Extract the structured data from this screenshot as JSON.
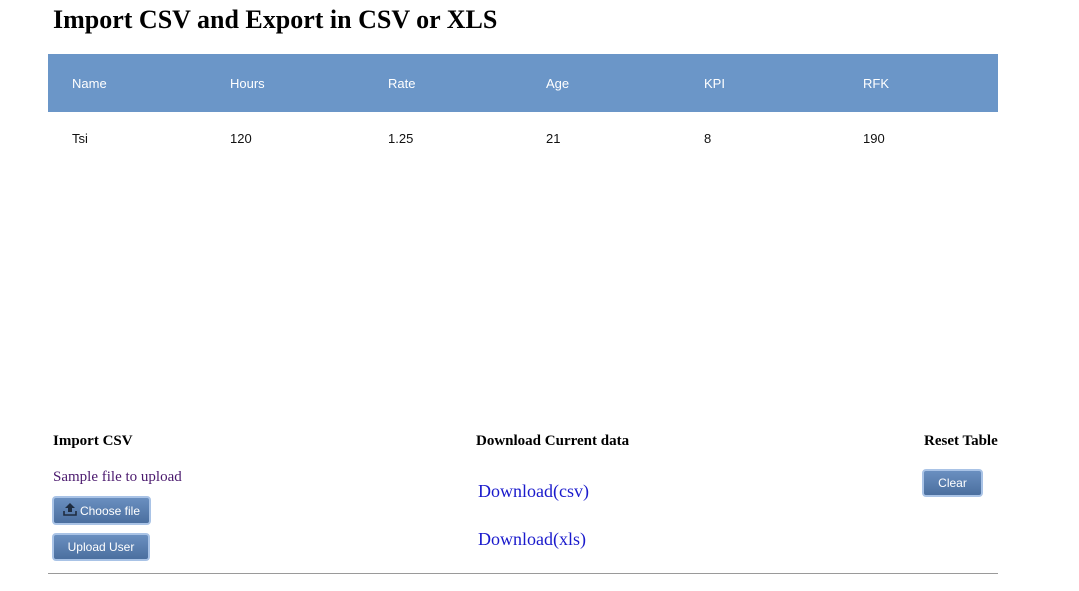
{
  "page": {
    "title": "Import CSV and Export in CSV or XLS"
  },
  "table": {
    "columns": [
      "Name",
      "Hours",
      "Rate",
      "Age",
      "KPI",
      "RFK"
    ],
    "rows": [
      [
        "Tsi",
        "120",
        "1.25",
        "21",
        "8",
        "190"
      ]
    ]
  },
  "import_section": {
    "heading": "Import CSV",
    "sample_link": "Sample file to upload",
    "choose_file_label": "Choose file",
    "upload_label": "Upload User"
  },
  "download_section": {
    "heading": "Download Current data",
    "csv_label": "Download(csv)",
    "xls_label": "Download(xls)"
  },
  "reset_section": {
    "heading": "Reset Table",
    "clear_label": "Clear"
  },
  "icons": {
    "choose_file": "upload-icon"
  },
  "colors": {
    "table_header": "#6b96c8",
    "button": "#5a7fb0",
    "link": "#1a1acc",
    "visited_link": "#4b1a6e"
  }
}
